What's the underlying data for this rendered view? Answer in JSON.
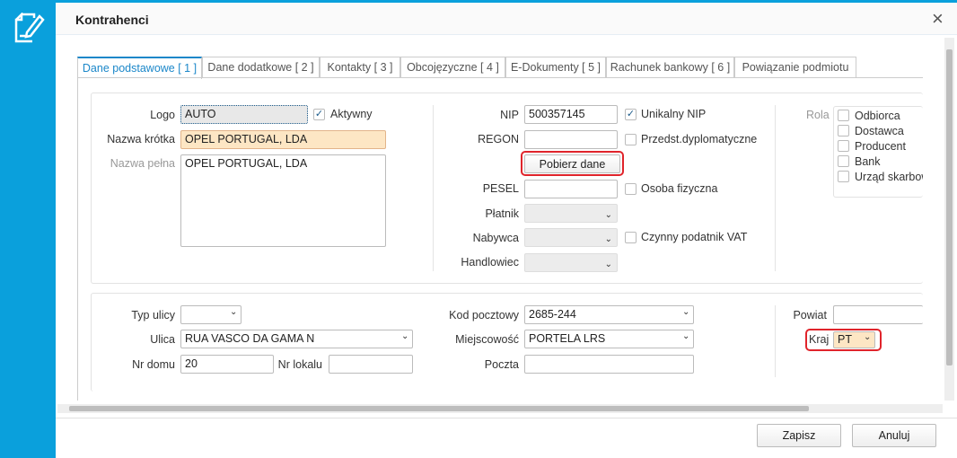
{
  "window": {
    "title": "Kontrahenci",
    "close_icon": "×"
  },
  "tabs": [
    "Dane podstawowe [ 1 ]",
    "Dane dodatkowe [ 2 ]",
    "Kontakty [ 3 ]",
    "Obcojęzyczne [ 4 ]",
    "E-Dokumenty [ 5 ]",
    "Rachunek bankowy [ 6 ]",
    "Powiązanie podmiotu"
  ],
  "basic": {
    "logo_label": "Logo",
    "logo_value": "AUTO",
    "aktywny_label": "Aktywny",
    "aktywny_checked": true,
    "short_name_label": "Nazwa krótka",
    "short_name_value": "OPEL PORTUGAL, LDA",
    "full_name_label": "Nazwa pełna",
    "full_name_value": "OPEL PORTUGAL, LDA",
    "nip_label": "NIP",
    "nip_value": "500357145",
    "unique_nip_label": "Unikalny NIP",
    "unique_nip_checked": true,
    "regon_label": "REGON",
    "regon_value": "",
    "diplomatic_label": "Przedst.dyplomatyczne",
    "fetch_button": "Pobierz dane",
    "pesel_label": "PESEL",
    "pesel_value": "",
    "natural_person_label": "Osoba fizyczna",
    "payer_label": "Płatnik",
    "buyer_label": "Nabywca",
    "vat_label": "Czynny podatnik VAT",
    "salesman_label": "Handlowiec",
    "role_label": "Rola",
    "roles": [
      "Odbiorca",
      "Dostawca",
      "Producent",
      "Bank",
      "Urząd skarbow"
    ]
  },
  "address": {
    "street_type_label": "Typ ulicy",
    "street_type_value": "",
    "street_label": "Ulica",
    "street_value": "RUA VASCO DA GAMA N",
    "house_label": "Nr domu",
    "house_value": "20",
    "flat_label": "Nr lokalu",
    "flat_value": "",
    "postcode_label": "Kod pocztowy",
    "postcode_value": "2685-244",
    "city_label": "Miejscowość",
    "city_value": "PORTELA LRS",
    "post_label": "Poczta",
    "post_value": "",
    "county_label": "Powiat",
    "county_value": "",
    "country_label": "Kraj",
    "country_value": "PT"
  },
  "footer": {
    "save": "Zapisz",
    "cancel": "Anuluj"
  }
}
